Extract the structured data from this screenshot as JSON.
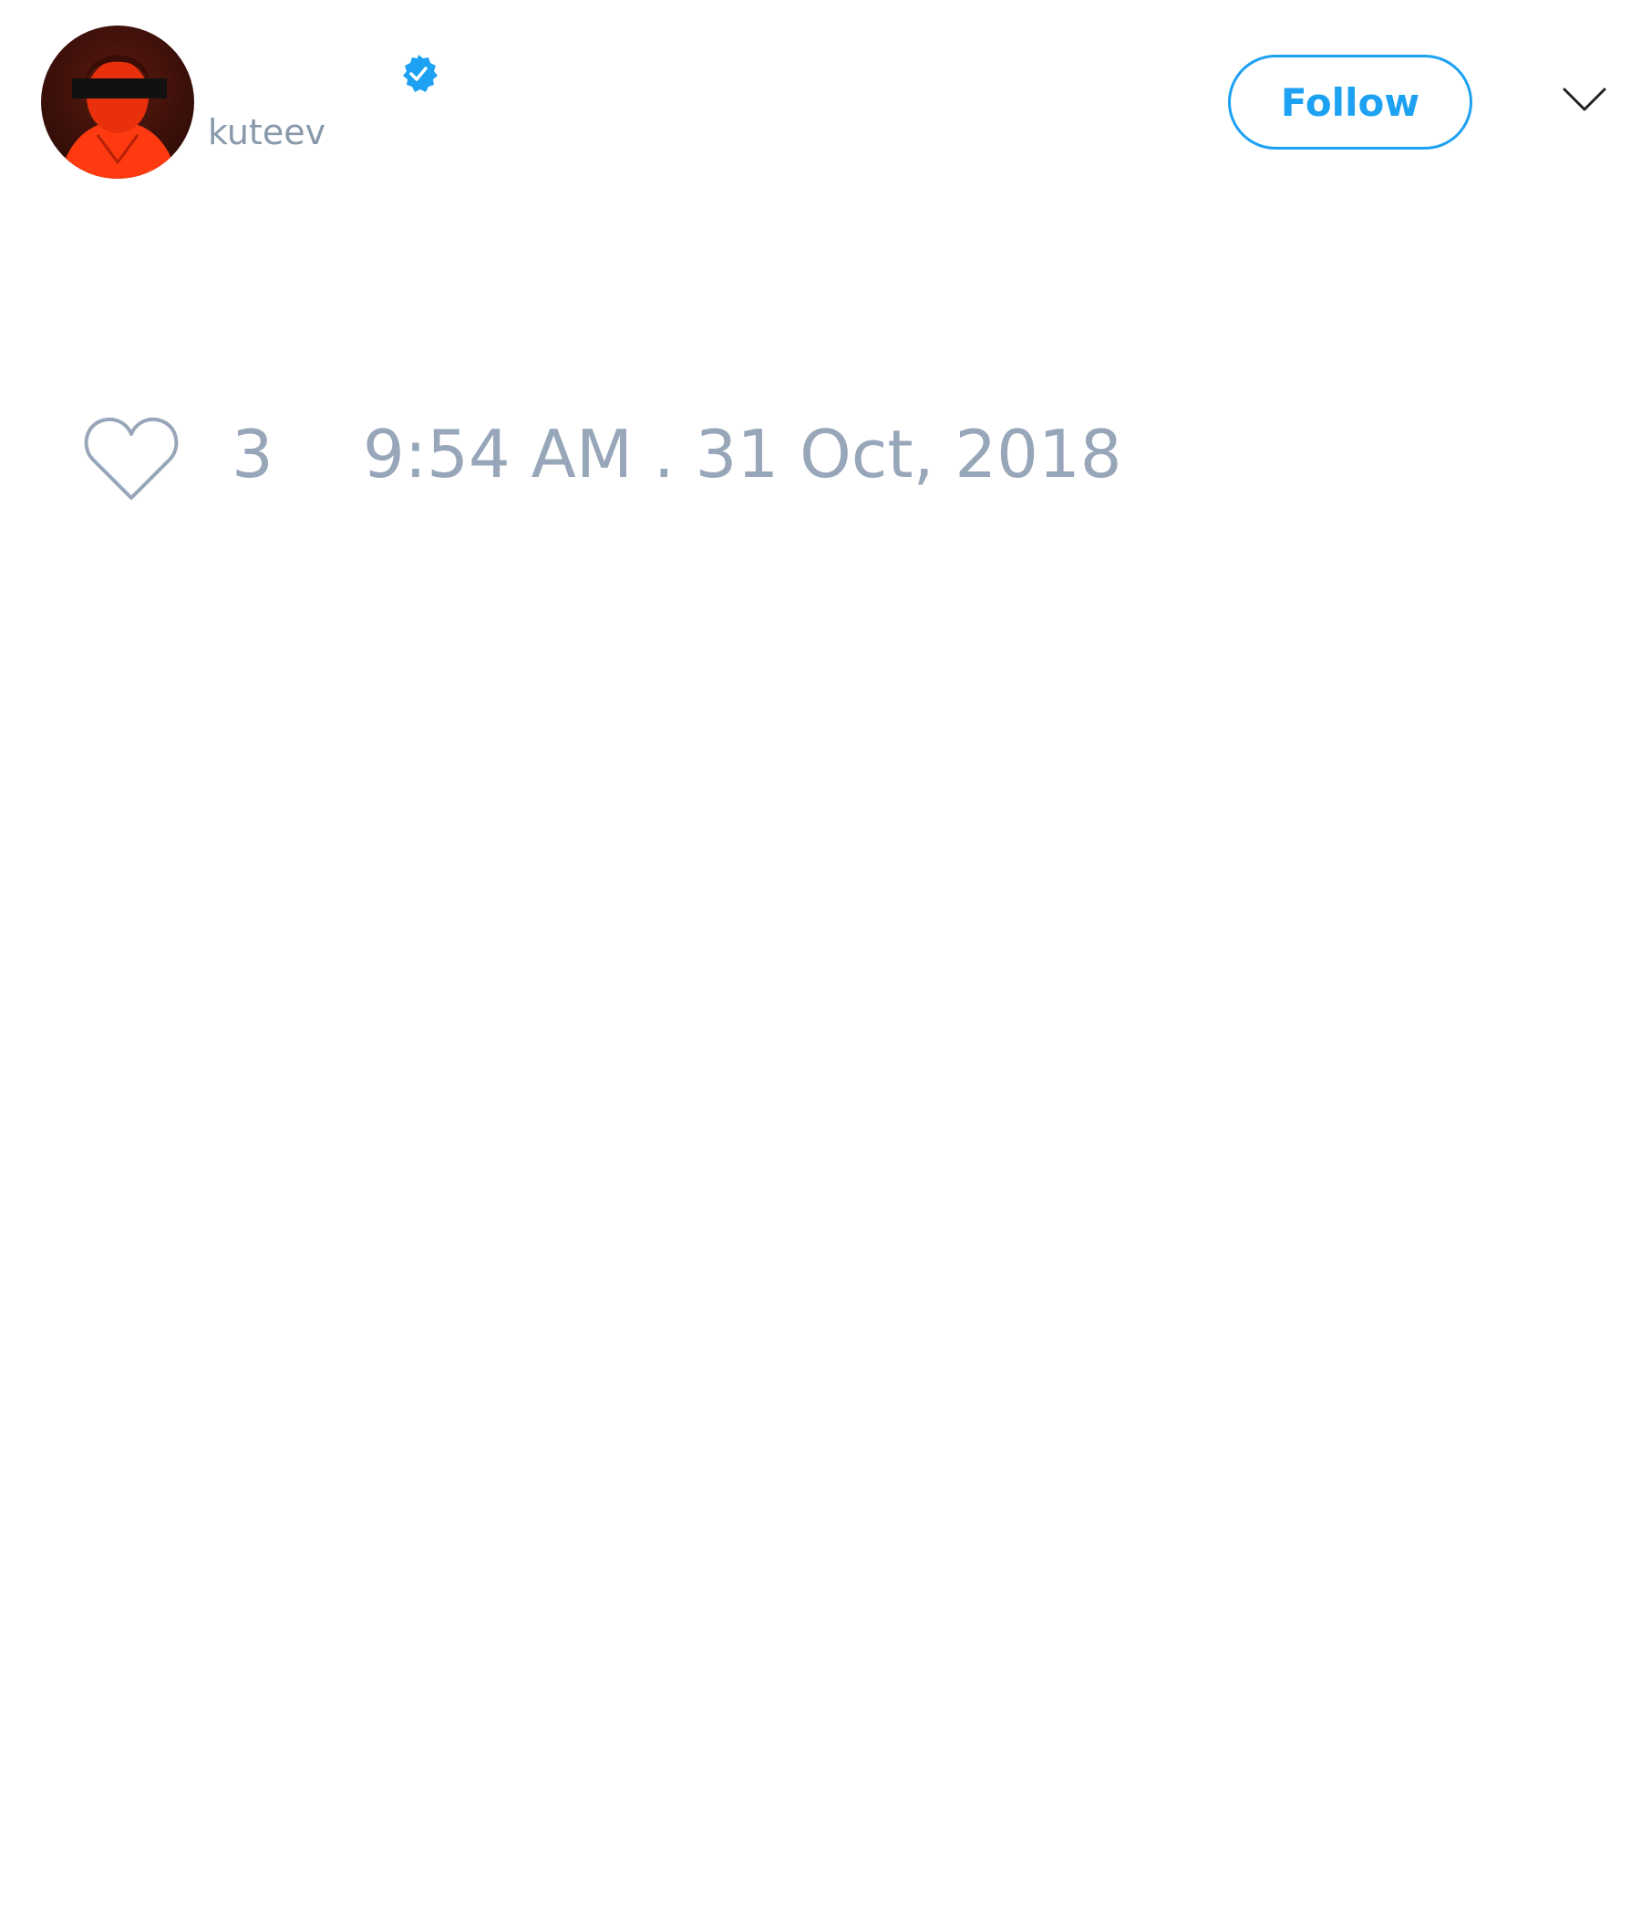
{
  "tweet": {
    "author": {
      "handle": "kuteev",
      "verified": true,
      "avatar_icon": "profile-photo"
    },
    "follow_label": "Follow",
    "menu_icon": "chevron-down-icon",
    "likes": {
      "icon": "heart-icon",
      "count": "3"
    },
    "timestamp": "9:54 AM . 31 Oct, 2018"
  },
  "colors": {
    "accent": "#1da1f2",
    "muted_text": "#97a6b9",
    "handle_text": "#8899aa",
    "background": "#ffffff"
  }
}
